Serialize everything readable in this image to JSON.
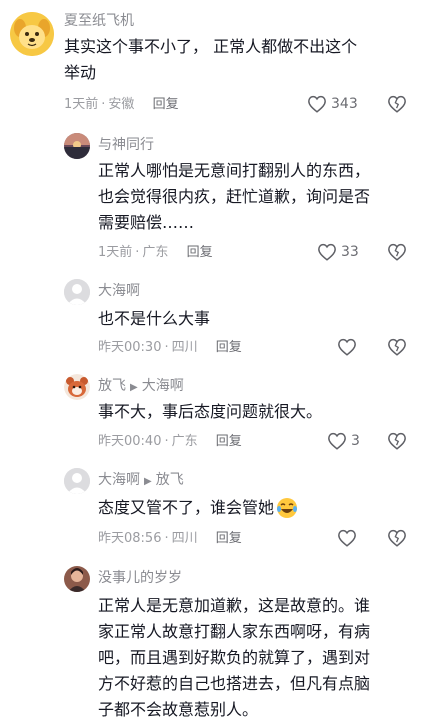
{
  "comments": [
    {
      "user": "夏至纸飞机",
      "lines": [
        "其实这个事不小了， 正常人都做不出这个",
        "举动"
      ],
      "time": "1天前",
      "location": "安徽",
      "reply": "回复",
      "likes": "343",
      "avatar_icon": "dog-cartoon-avatar"
    },
    {
      "user": "与神同行",
      "lines": [
        "正常人哪怕是无意间打翻别人的东西，",
        "也会觉得很内疚，赶忙道歉，询问是否",
        "需要赔偿……"
      ],
      "time": "1天前",
      "location": "广东",
      "reply": "回复",
      "likes": "33",
      "avatar_icon": "sunset-landscape-avatar"
    },
    {
      "user": "大海啊",
      "lines": [
        "也不是什么大事"
      ],
      "time": "昨天00:30",
      "location": "四川",
      "reply": "回复",
      "likes": "",
      "avatar_icon": "default-user-avatar"
    },
    {
      "user": "放飞",
      "reply_to": "大海啊",
      "lines": [
        "事不大，事后态度问题就很大。"
      ],
      "time": "昨天00:40",
      "location": "广东",
      "reply": "回复",
      "likes": "3",
      "avatar_icon": "cartoon-red-panda-avatar"
    },
    {
      "user": "大海啊",
      "reply_to": "放飞",
      "lines": [
        "态度又管不了，谁会管她"
      ],
      "time": "昨天08:56",
      "location": "四川",
      "reply": "回复",
      "likes": "",
      "emoji": "crying-laughing-emoji",
      "avatar_icon": "default-user-avatar"
    },
    {
      "user": "没事儿的岁岁",
      "lines": [
        "正常人是无意加道歉，这是故意的。谁",
        "家正常人故意打翻人家东西啊呀，有病",
        "吧，而且遇到好欺负的就算了，遇到对",
        "方不好惹的自己也搭进去，但凡有点脑",
        "子都不会故意惹别人。"
      ],
      "avatar_icon": "photo-avatar"
    }
  ],
  "colors": {
    "text": "#161823",
    "meta": "#9b9ca1",
    "username": "#8a8b91"
  }
}
